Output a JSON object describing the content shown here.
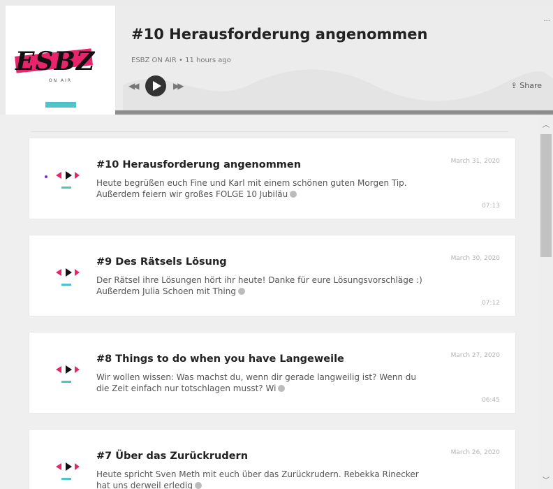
{
  "player": {
    "title": "#10 Herausforderung angenommen",
    "meta": "ESBZ ON AIR • 11 hours ago",
    "share_label": "Share",
    "menu_label": "...",
    "cover_logo_text": "ESBZ",
    "cover_subtitle": "ON AIR",
    "progress": 0.0
  },
  "episodes": [
    {
      "title": "#10 Herausforderung angenommen",
      "description": "Heute begrüßen euch Fine und Karl mit einem schönen guten Morgen Tip. Außerdem feiern wir großes FOLGE 10 Jubiläu",
      "date": "March 31, 2020",
      "duration": "07:13"
    },
    {
      "title": "#9 Des Rätsels Lösung",
      "description": "Der Rätsel ihre Lösungen hört ihr heute! Danke für eure Lösungsvorschläge :) Außerdem Julia Schoen mit Thing",
      "date": "March 30, 2020",
      "duration": "07:12"
    },
    {
      "title": "#8 Things to do when you have Langeweile",
      "description": "Wir wollen wissen: Was machst du, wenn dir gerade langweilig ist? Wenn du die Zeit einfach nur totschlagen musst? Wi",
      "date": "March 27, 2020",
      "duration": "06:45"
    },
    {
      "title": "#7 Über das Zurückrudern",
      "description": "Heute spricht Sven Meth mit euch über das Zurückrudern. Rebekka Rinecker hat uns derweil erledig",
      "date": "March 26, 2020",
      "duration": ""
    }
  ],
  "colors": {
    "accent_pink": "#e8246d",
    "accent_teal": "#4fc3c9",
    "play_button": "#333333"
  },
  "icons": {
    "rewind": "rewind-icon",
    "play": "play-icon",
    "fast_forward": "fast-forward-icon",
    "share": "share-icon",
    "more": "more-icon",
    "scroll_up": "chevron-up-icon",
    "scroll_down": "chevron-down-icon"
  }
}
